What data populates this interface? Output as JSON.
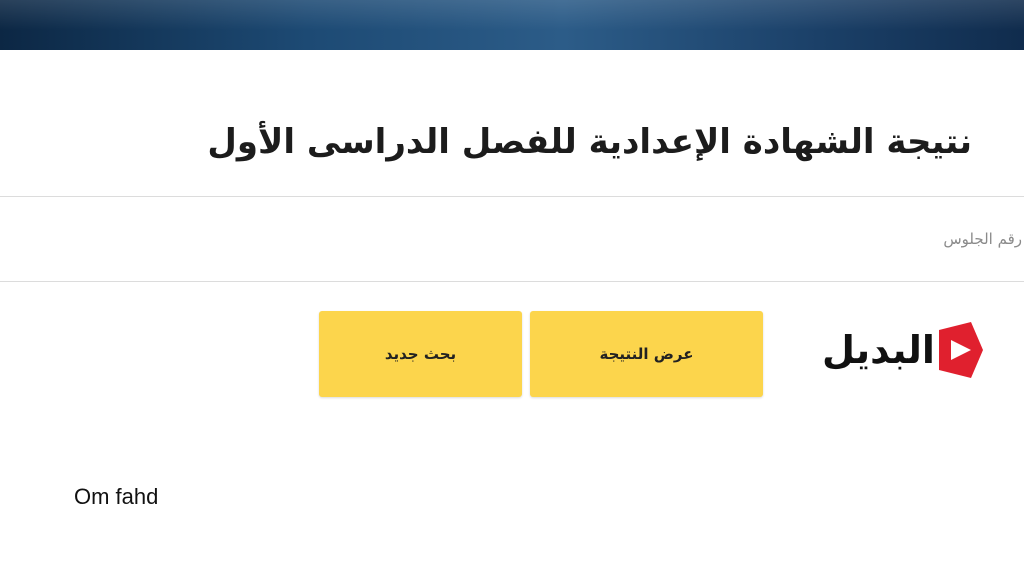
{
  "header": {
    "title": "نتيجة الشهادة الإعدادية للفصل الدراسى الأول"
  },
  "form": {
    "seat_number_placeholder": "رقم الجلوس"
  },
  "actions": {
    "show_result_label": "عرض النتيجة",
    "new_search_label": "بحث جديد"
  },
  "logo": {
    "text": "البديل",
    "accent_color": "#e0202e"
  },
  "credit": {
    "text": "Om fahd"
  },
  "colors": {
    "button_yellow": "#fcd54c",
    "banner_blue": "#1d4a74"
  }
}
